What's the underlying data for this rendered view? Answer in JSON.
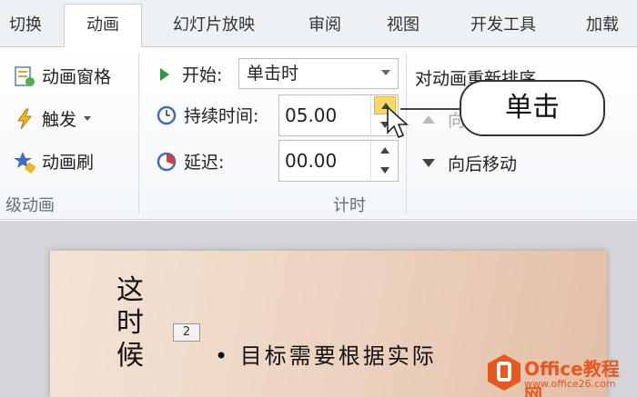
{
  "tabs": [
    "切换",
    "动画",
    "幻灯片放映",
    "审阅",
    "视图",
    "开发工具",
    "加载"
  ],
  "advanced_group": {
    "items": [
      "动画窗格",
      "触发",
      "动画刷"
    ],
    "label": "级动画"
  },
  "timing_group": {
    "start_label": "开始:",
    "start_value": "单击时",
    "duration_label": "持续时间:",
    "duration_value": "05.00",
    "delay_label": "延迟:",
    "delay_value": "00.00",
    "label": "计时"
  },
  "reorder_group": {
    "title": "对动画重新排序",
    "move_earlier": "向",
    "move_later": "向后移动"
  },
  "callout": "单击",
  "slide": {
    "vertical_text": "这时候",
    "animation_tag": "2",
    "bullet": "目标需要根据实际"
  },
  "watermark": {
    "brand": "Office教程网",
    "url": "www.office26.com"
  },
  "colors": {
    "highlight": "#f9d869",
    "accent_green": "#2e9a3a",
    "watermark": "#e8571e"
  }
}
